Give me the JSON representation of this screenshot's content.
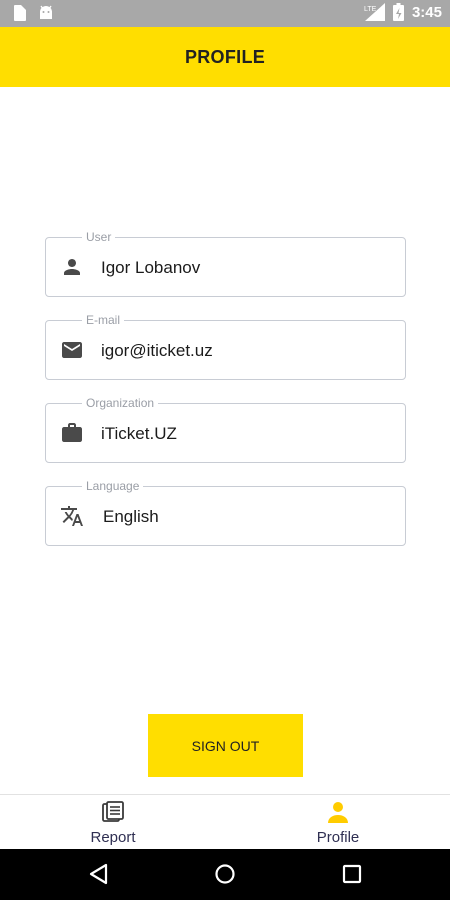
{
  "status_bar": {
    "time": "3:45",
    "icons": [
      "sim-card-icon",
      "android-icon",
      "lte-signal-icon",
      "battery-icon"
    ]
  },
  "header": {
    "title": "PROFILE"
  },
  "fields": [
    {
      "label": "User",
      "value": "Igor Lobanov",
      "icon": "person-icon"
    },
    {
      "label": "E-mail",
      "value": "igor@iticket.uz",
      "icon": "mail-icon"
    },
    {
      "label": "Organization",
      "value": "iTicket.UZ",
      "icon": "briefcase-icon"
    },
    {
      "label": "Language",
      "value": "English",
      "icon": "translate-icon"
    }
  ],
  "signout_label": "SIGN OUT",
  "bottom_nav": {
    "items": [
      {
        "label": "Report",
        "icon": "report-icon",
        "active": false
      },
      {
        "label": "Profile",
        "icon": "profile-icon",
        "active": true
      }
    ]
  },
  "colors": {
    "accent": "#ffde00",
    "status_bar": "#a8a8a8",
    "nav_label": "#2f2f52"
  }
}
